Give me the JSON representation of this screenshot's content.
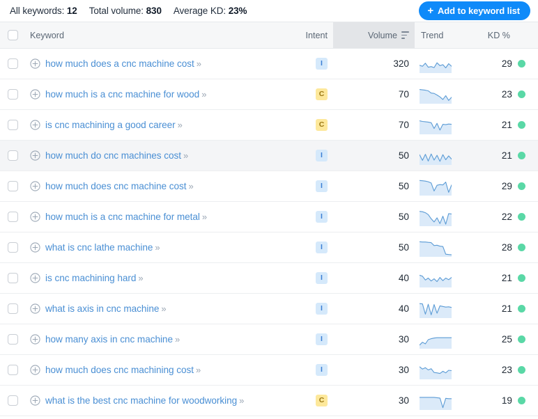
{
  "summary": {
    "all_keywords_label": "All keywords:",
    "all_keywords_value": "12",
    "total_volume_label": "Total volume:",
    "total_volume_value": "830",
    "average_kd_label": "Average KD:",
    "average_kd_value": "23%"
  },
  "toolbar": {
    "add_to_list_label": "Add to keyword list",
    "add_icon": "plus-icon",
    "accent_color": "#0f8af9"
  },
  "table": {
    "columns": {
      "keyword": "Keyword",
      "intent": "Intent",
      "volume": "Volume",
      "trend": "Trend",
      "kd": "KD %"
    },
    "sorted_column": "volume",
    "sort_icon": "sort-descending-icon",
    "hovered_row_index": 3,
    "row_expand_icon": "plus-circle-icon",
    "keyword_chevron": "»",
    "kd_dot_color": "#5ad8a6",
    "rows": [
      {
        "keyword": "how much does a cnc machine cost",
        "intent": "I",
        "volume": "320",
        "kd": "29",
        "trend": [
          42,
          36,
          55,
          30,
          34,
          28,
          58,
          40,
          46,
          26,
          52,
          36
        ]
      },
      {
        "keyword": "how much is a cnc machine for wood",
        "intent": "C",
        "volume": "70",
        "kd": "23",
        "trend": [
          82,
          80,
          78,
          74,
          60,
          58,
          48,
          36,
          20,
          44,
          14,
          34
        ]
      },
      {
        "keyword": "is cnc machining a good career",
        "intent": "C",
        "volume": "70",
        "kd": "21",
        "trend": [
          78,
          74,
          72,
          70,
          66,
          30,
          62,
          20,
          56,
          54,
          58,
          56
        ]
      },
      {
        "keyword": "how much do cnc machines cost",
        "intent": "I",
        "volume": "50",
        "kd": "21",
        "trend": [
          58,
          22,
          60,
          18,
          62,
          24,
          54,
          16,
          58,
          26,
          50,
          30
        ]
      },
      {
        "keyword": "how much does cnc machine cost",
        "intent": "I",
        "volume": "50",
        "kd": "29",
        "trend": [
          88,
          86,
          84,
          80,
          72,
          22,
          58,
          62,
          60,
          78,
          14,
          60
        ]
      },
      {
        "keyword": "how much is a cnc machine for metal",
        "intent": "I",
        "volume": "50",
        "kd": "22",
        "trend": [
          86,
          84,
          78,
          66,
          40,
          20,
          46,
          10,
          56,
          6,
          72,
          70
        ]
      },
      {
        "keyword": "what is cnc lathe machine",
        "intent": "I",
        "volume": "50",
        "kd": "28",
        "trend": [
          88,
          86,
          86,
          84,
          82,
          64,
          66,
          60,
          58,
          10,
          8,
          6
        ]
      },
      {
        "keyword": "is cnc machining hard",
        "intent": "I",
        "volume": "40",
        "kd": "21",
        "trend": [
          70,
          64,
          40,
          52,
          34,
          48,
          30,
          56,
          36,
          52,
          42,
          56
        ]
      },
      {
        "keyword": "what is axis in cnc machine",
        "intent": "I",
        "volume": "40",
        "kd": "21",
        "trend": [
          84,
          82,
          18,
          80,
          14,
          78,
          24,
          70,
          66,
          62,
          64,
          60
        ]
      },
      {
        "keyword": "how many axis in cnc machine",
        "intent": "I",
        "volume": "30",
        "kd": "25",
        "trend": [
          16,
          34,
          24,
          50,
          56,
          60,
          62,
          62,
          62,
          62,
          62,
          62
        ]
      },
      {
        "keyword": "how much does cnc machining cost",
        "intent": "I",
        "volume": "30",
        "kd": "23",
        "trend": [
          72,
          58,
          66,
          52,
          60,
          36,
          34,
          30,
          44,
          34,
          50,
          48
        ]
      },
      {
        "keyword": "what is the best cnc machine for woodworking",
        "intent": "C",
        "volume": "30",
        "kd": "19",
        "trend": [
          72,
          72,
          72,
          72,
          72,
          72,
          70,
          68,
          8,
          66,
          64,
          64
        ]
      }
    ]
  }
}
